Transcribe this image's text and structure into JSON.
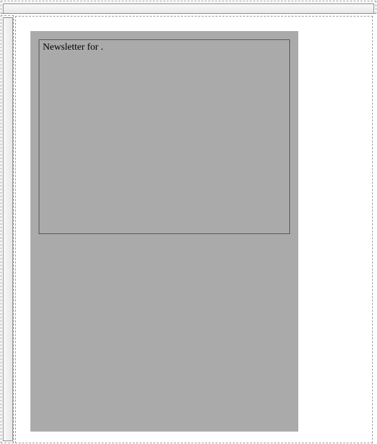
{
  "document": {
    "textFrame": {
      "content": "Newsletter for ."
    }
  }
}
